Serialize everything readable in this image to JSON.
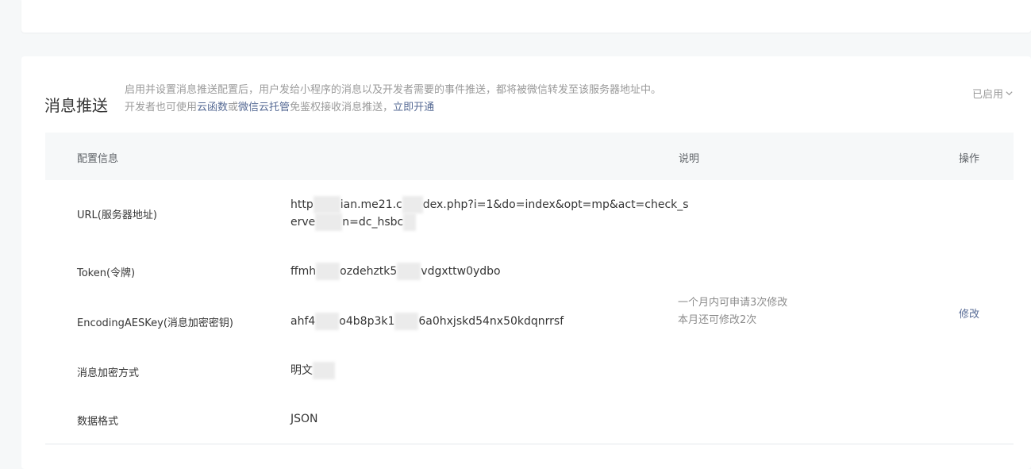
{
  "section": {
    "title": "消息推送",
    "desc_line1": "启用并设置消息推送配置后，用户发给小程序的消息以及开发者需要的事件推送，都将被微信转发至该服务器地址中。",
    "desc_line2_prefix": "开发者也可使用",
    "desc_link_cloud_function": "云函数",
    "desc_or": "或",
    "desc_link_cloud_hosting": "微信云托管",
    "desc_line2_suffix": "免鉴权接收消息推送，",
    "desc_link_enable": "立即开通",
    "status": "已启用"
  },
  "table": {
    "headers": {
      "config": "配置信息",
      "note": "说明",
      "action": "操作"
    },
    "rows": {
      "url": {
        "label": "URL(服务器地址)",
        "value_line1_a": "http",
        "value_line1_b": "ian.me21.c",
        "value_line1_c": "dex.php?i=1&do=index&opt=mp&act=check_s",
        "value_line2_a": "erve",
        "value_line2_b": "n=dc_hsbc"
      },
      "token": {
        "label": "Token(令牌)",
        "value_a": "ffmh",
        "value_b": "ozdehztk5",
        "value_c": "vdgxttw0ydbo"
      },
      "aeskey": {
        "label": "EncodingAESKey(消息加密密钥)",
        "value_a": "ahf4",
        "value_b": "o4b8p3k1",
        "value_c": "6a0hxjskd54nx50kdqnrrsf",
        "note_line1": "一个月内可申请3次修改",
        "note_line2": "本月还可修改2次",
        "action": "修改"
      },
      "encrypt": {
        "label": "消息加密方式",
        "value": "明文"
      },
      "format": {
        "label": "数据格式",
        "value": "JSON"
      }
    }
  },
  "colors": {
    "link": "#576b95",
    "muted": "#9a9a9a",
    "header_bg": "#f6f8f9"
  },
  "icons": {
    "status_dropdown": "chevron-down-icon"
  }
}
